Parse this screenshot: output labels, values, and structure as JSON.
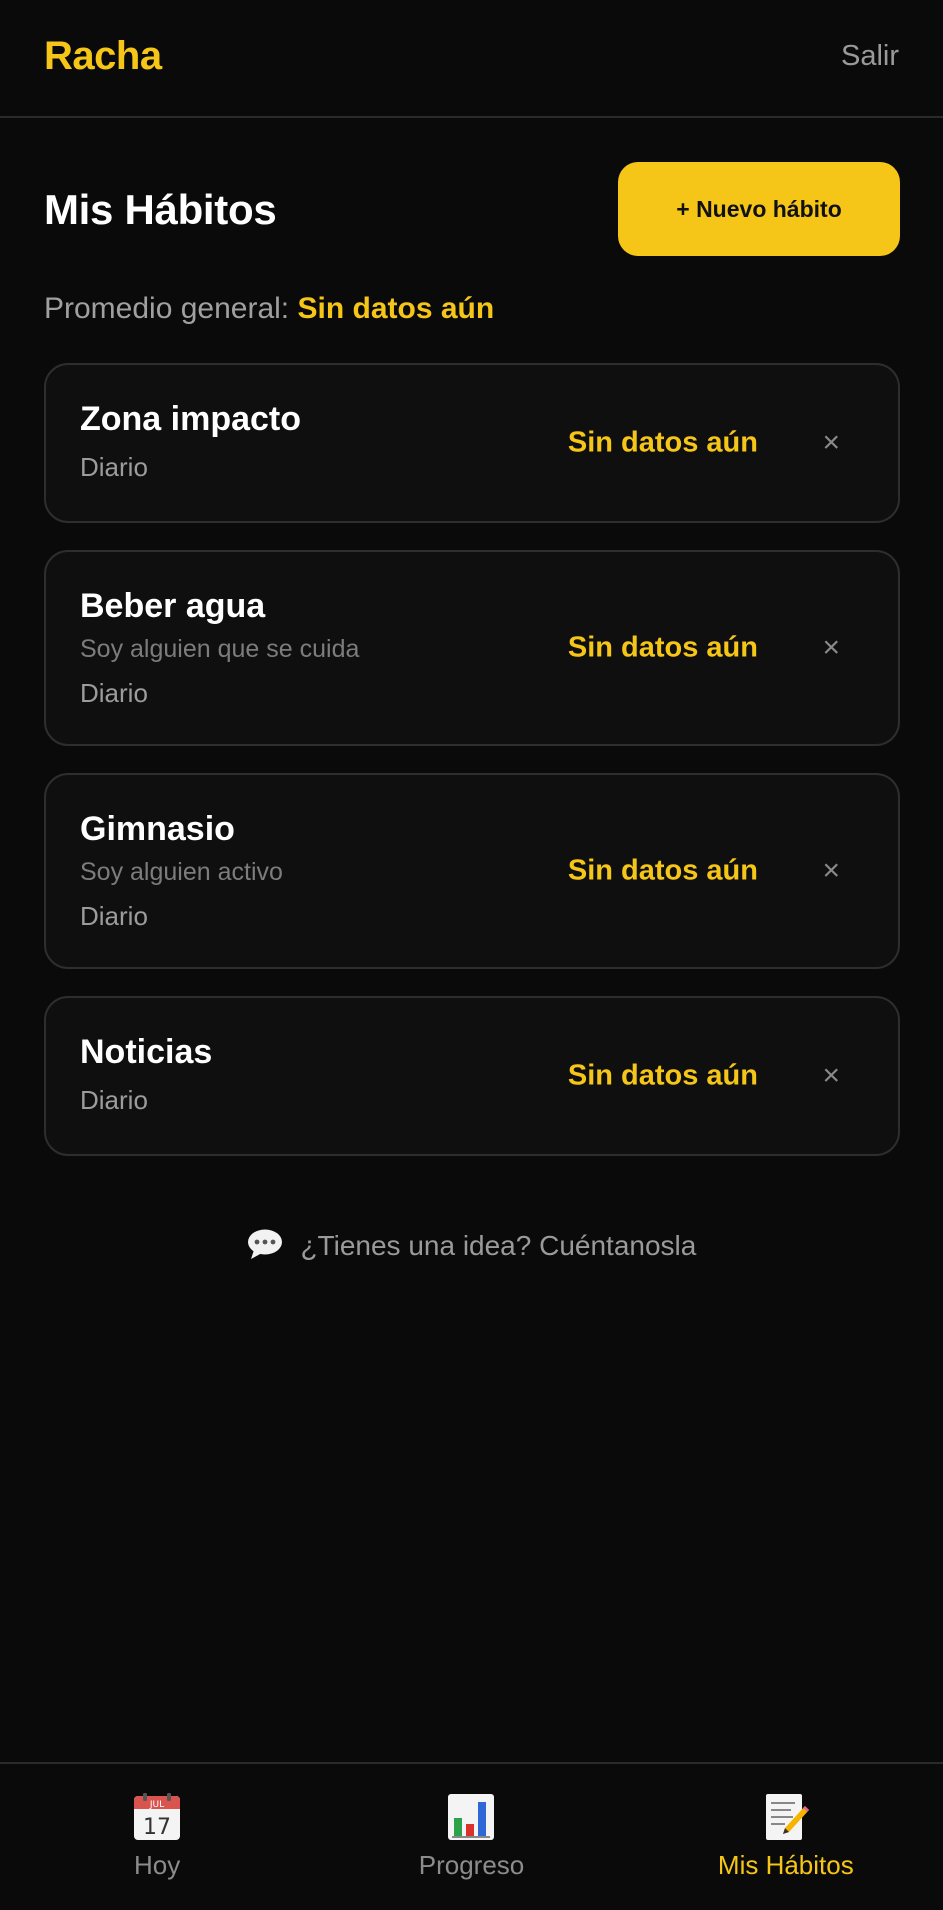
{
  "header": {
    "brand": "Racha",
    "logout_label": "Salir"
  },
  "page": {
    "title": "Mis Hábitos",
    "new_habit_label": "+ Nuevo hábito",
    "average_label": "Promedio general:",
    "average_value": "Sin datos aún"
  },
  "habits": [
    {
      "name": "Zona impacto",
      "identity": "",
      "frequency": "Diario",
      "status": "Sin datos aún",
      "delete_glyph": "×"
    },
    {
      "name": "Beber agua",
      "identity": "Soy alguien que se cuida",
      "frequency": "Diario",
      "status": "Sin datos aún",
      "delete_glyph": "×"
    },
    {
      "name": "Gimnasio",
      "identity": "Soy alguien activo",
      "frequency": "Diario",
      "status": "Sin datos aún",
      "delete_glyph": "×"
    },
    {
      "name": "Noticias",
      "identity": "",
      "frequency": "Diario",
      "status": "Sin datos aún",
      "delete_glyph": "×"
    }
  ],
  "feedback": {
    "icon": "speech-bubble-icon",
    "label": "¿Tienes una idea? Cuéntanosla"
  },
  "nav": {
    "items": [
      {
        "label": "Hoy",
        "icon": "calendar-icon",
        "calendar_month": "JUL",
        "calendar_day": "17",
        "active": false
      },
      {
        "label": "Progreso",
        "icon": "bar-chart-icon",
        "active": false
      },
      {
        "label": "Mis Hábitos",
        "icon": "memo-icon",
        "active": true
      }
    ]
  },
  "colors": {
    "accent": "#f5c518",
    "background": "#0a0a0a",
    "card_border": "#2e2e2e",
    "muted_text": "#9a9a9a"
  }
}
